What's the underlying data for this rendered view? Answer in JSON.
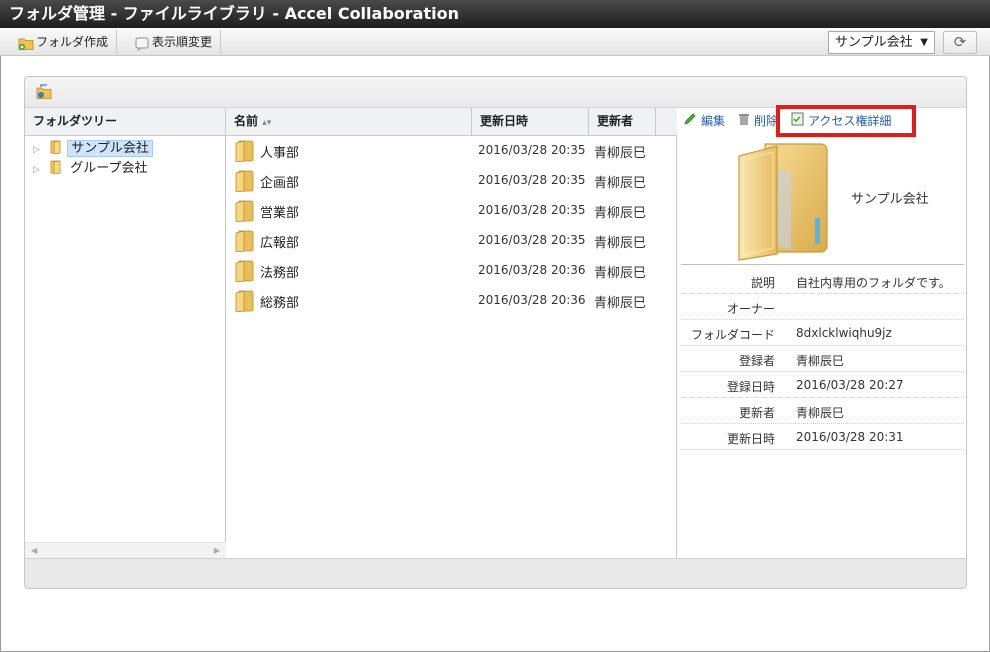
{
  "window": {
    "title": "フォルダ管理 - ファイルライブラリ - Accel Collaboration"
  },
  "toolbar": {
    "create_folder": "フォルダ作成",
    "change_order": "表示順変更",
    "company_select": "サンプル会社",
    "icons": {
      "create": "folder-add-icon",
      "order": "sort-order-icon",
      "refresh": "refresh-icon"
    }
  },
  "tree": {
    "header": "フォルダツリー",
    "items": [
      {
        "label": "サンプル会社",
        "selected": true
      },
      {
        "label": "グループ会社",
        "selected": false
      }
    ]
  },
  "list": {
    "columns": {
      "name": "名前",
      "updated_at": "更新日時",
      "updated_by": "更新者"
    },
    "rows": [
      {
        "name": "人事部",
        "updated_at": "2016/03/28 20:35",
        "updated_by": "青柳辰巳"
      },
      {
        "name": "企画部",
        "updated_at": "2016/03/28 20:35",
        "updated_by": "青柳辰巳"
      },
      {
        "name": "営業部",
        "updated_at": "2016/03/28 20:35",
        "updated_by": "青柳辰巳"
      },
      {
        "name": "広報部",
        "updated_at": "2016/03/28 20:35",
        "updated_by": "青柳辰巳"
      },
      {
        "name": "法務部",
        "updated_at": "2016/03/28 20:36",
        "updated_by": "青柳辰巳"
      },
      {
        "name": "総務部",
        "updated_at": "2016/03/28 20:36",
        "updated_by": "青柳辰巳"
      }
    ]
  },
  "detail": {
    "actions": {
      "edit": "編集",
      "delete": "削除",
      "access": "アクセス権詳細"
    },
    "folder_name": "サンプル会社",
    "props": [
      {
        "key": "説明",
        "value": "自社内専用のフォルダです。"
      },
      {
        "key": "オーナー",
        "value": ""
      },
      {
        "key": "フォルダコード",
        "value": "8dxlcklwiqhu9jz"
      },
      {
        "key": "登録者",
        "value": "青柳辰巳"
      },
      {
        "key": "登録日時",
        "value": "2016/03/28 20:27"
      },
      {
        "key": "更新者",
        "value": "青柳辰巳"
      },
      {
        "key": "更新日時",
        "value": "2016/03/28 20:31"
      }
    ]
  },
  "colors": {
    "highlight": "#e21b1b",
    "link": "#1f5fb0",
    "selection": "#cfe3fb"
  }
}
